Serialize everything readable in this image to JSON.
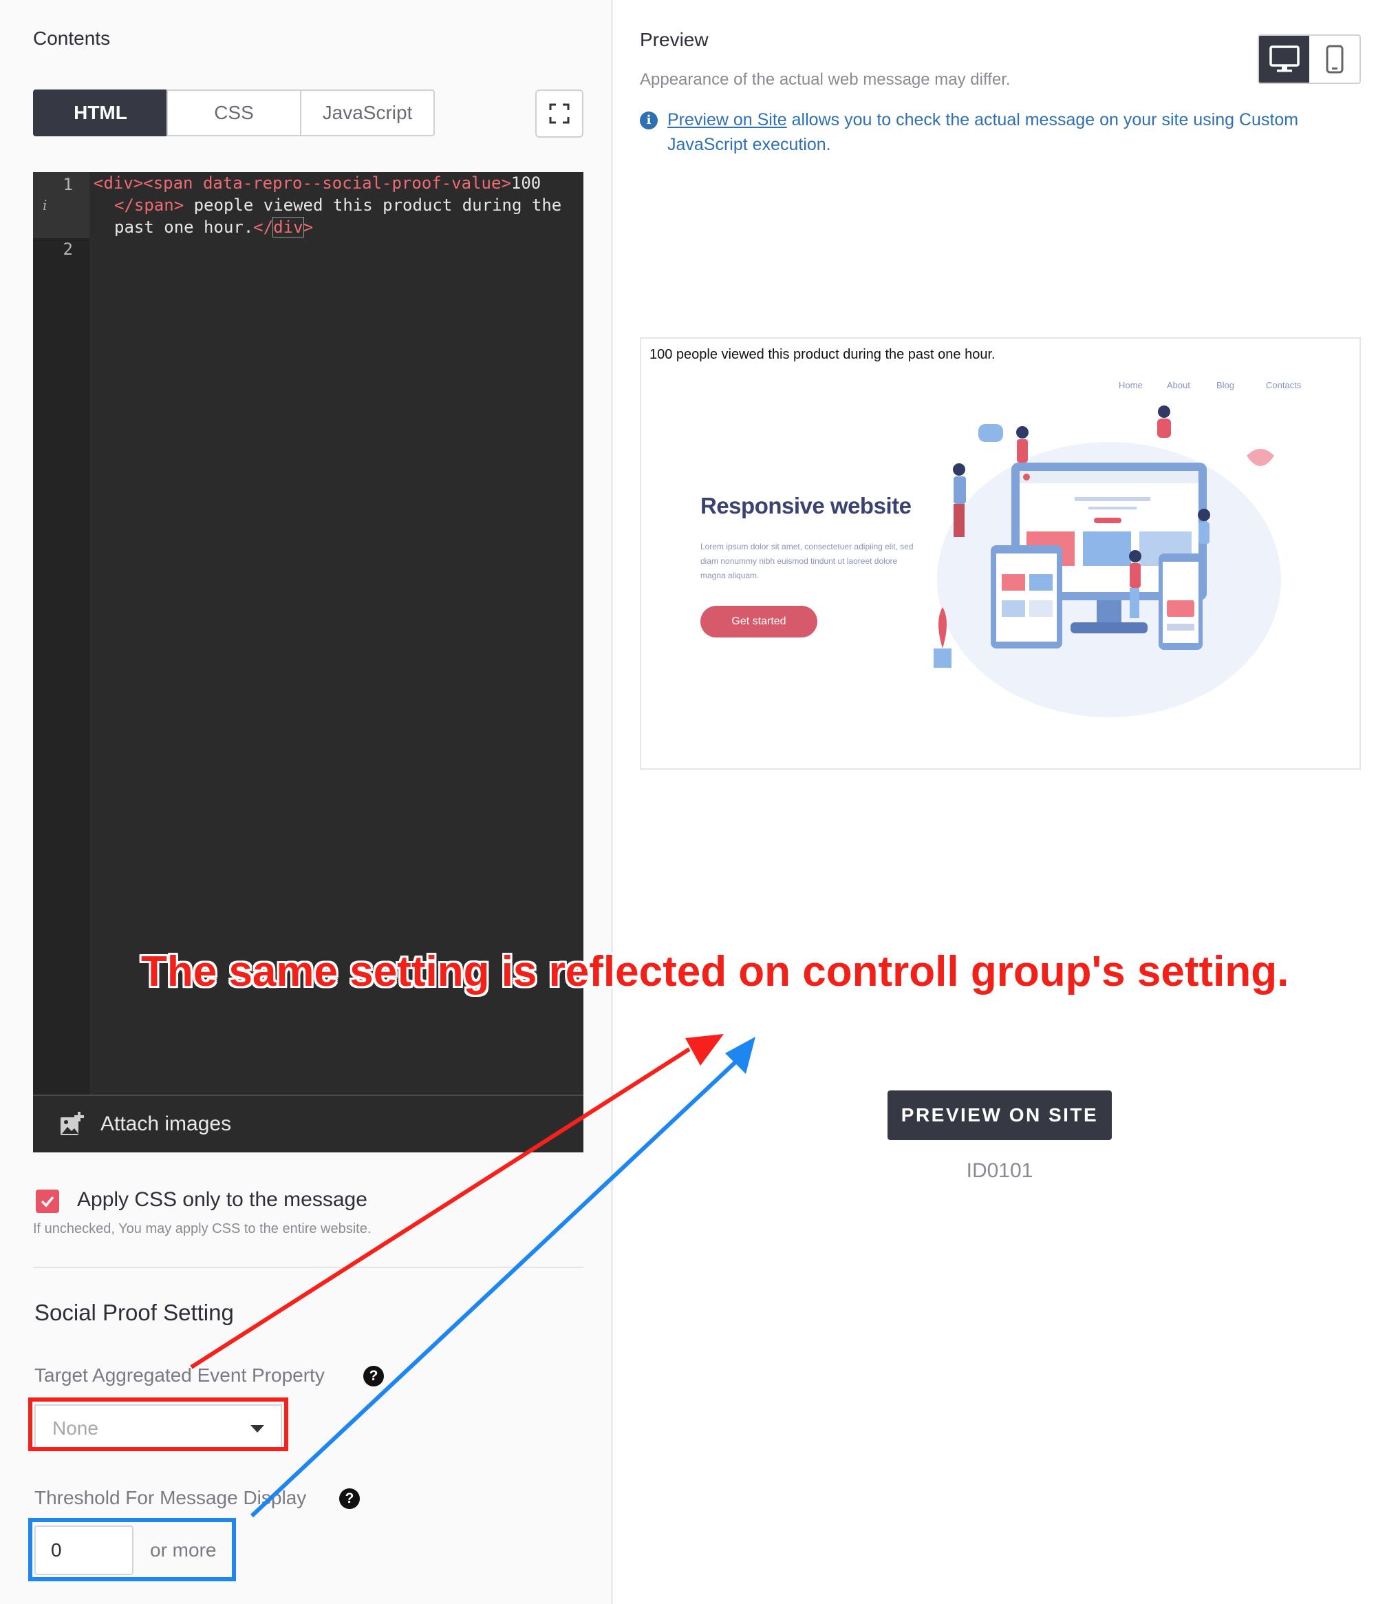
{
  "contents": {
    "title": "Contents",
    "tabs": [
      {
        "label": "HTML",
        "active": true
      },
      {
        "label": "CSS",
        "active": false
      },
      {
        "label": "JavaScript",
        "active": false
      }
    ],
    "editor": {
      "line_numbers": [
        "1",
        "2"
      ],
      "code": {
        "l1_tag1": "<div><span",
        "l1_attr": " data-repro--social-proof-value",
        "l1_tag2": ">",
        "l1_text": "100",
        "l2_tag": "</span>",
        "l2_text": " people viewed this product during the",
        "l3_text": "past one hour.",
        "l3_tag_open": "</",
        "l3_tag_name": "div",
        "l3_tag_close": ">"
      }
    },
    "attach_images_label": "Attach images",
    "apply_css": {
      "checked": true,
      "label": "Apply CSS only to the message",
      "help": "If unchecked, You may apply CSS to the entire website."
    }
  },
  "social_proof": {
    "title": "Social Proof Setting",
    "target_property": {
      "label": "Target Aggregated Event Property",
      "value": "None"
    },
    "threshold": {
      "label": "Threshold For Message Display",
      "value": "0",
      "suffix": "or more"
    }
  },
  "preview": {
    "title": "Preview",
    "subtitle": "Appearance of the actual web message may differ.",
    "info_link": "Preview on Site",
    "info_text": " allows you to check the actual message on your site using Custom JavaScript execution.",
    "message_text": "100 people viewed this product during the past one hour.",
    "site": {
      "nav": [
        "Home",
        "About",
        "Blog",
        "Contacts"
      ],
      "heading": "Responsive website",
      "body": "Lorem ipsum dolor sit amet, consectetuer adipiing elit, sed diam nonummy nibh euismod tindunt ut laoreet dolore magna aliquam.",
      "button": "Get started"
    },
    "button_label": "PREVIEW ON SITE",
    "id": "ID0101"
  },
  "annotation": {
    "text": "The same setting is reflected on controll group's setting.",
    "colors": {
      "red": "#f6211a",
      "blue": "#1d86f0"
    }
  },
  "colors": {
    "dark": "#363944",
    "accent": "#e85466",
    "link": "#2e70b3"
  }
}
